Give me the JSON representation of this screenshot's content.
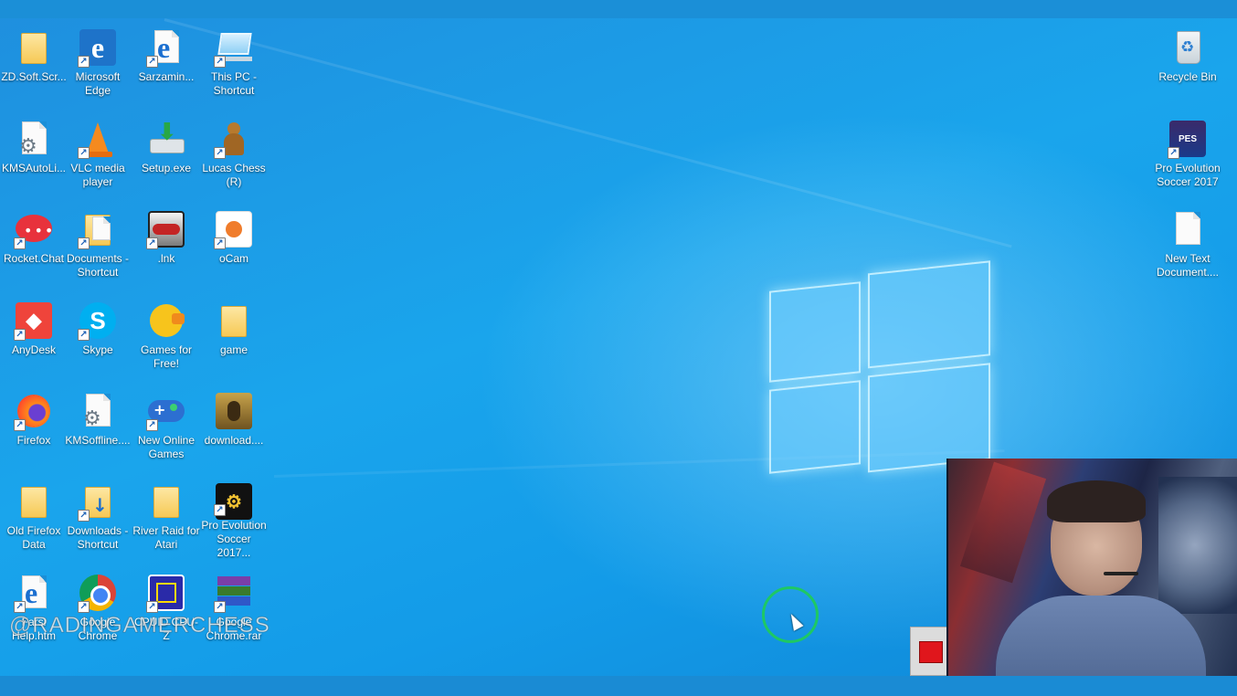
{
  "desktop": {
    "icons": [
      {
        "label": "ZD.Soft.Scr...",
        "icon": "folder-icon",
        "kind": "folder"
      },
      {
        "label": "Microsoft Edge",
        "icon": "edge-icon",
        "kind": "edge"
      },
      {
        "label": "Sarzamin...",
        "icon": "edge-icon",
        "kind": "edgepage"
      },
      {
        "label": "This PC - Shortcut",
        "icon": "this-pc-icon",
        "kind": "pc"
      },
      {
        "label": "KMSAutoLi...",
        "icon": "gear-file-icon",
        "kind": "gearpage"
      },
      {
        "label": "VLC media player",
        "icon": "vlc-cone-icon",
        "kind": "vlc"
      },
      {
        "label": "Setup.exe",
        "icon": "setup-installer-icon",
        "kind": "setup"
      },
      {
        "label": "Lucas Chess (R)",
        "icon": "chess-pawn-icon",
        "kind": "chess"
      },
      {
        "label": "Rocket.Chat",
        "icon": "rocket-chat-icon",
        "kind": "rocket"
      },
      {
        "label": "Documents - Shortcut",
        "icon": "documents-folder-icon",
        "kind": "docfolder"
      },
      {
        "label": ".lnk",
        "icon": "car-thumbnail-icon",
        "kind": "lnk"
      },
      {
        "label": "oCam",
        "icon": "ocam-icon",
        "kind": "ocam"
      },
      {
        "label": "AnyDesk",
        "icon": "anydesk-icon",
        "kind": "anydesk"
      },
      {
        "label": "Skype",
        "icon": "skype-icon",
        "kind": "skype"
      },
      {
        "label": "Games for Free!",
        "icon": "pacman-icon",
        "kind": "games"
      },
      {
        "label": "game",
        "icon": "folder-icon",
        "kind": "folder"
      },
      {
        "label": "Firefox",
        "icon": "firefox-icon",
        "kind": "firefox"
      },
      {
        "label": "KMSoffline....",
        "icon": "gear-file-icon",
        "kind": "gearpage"
      },
      {
        "label": "New Online Games",
        "icon": "gamepad-icon",
        "kind": "gamepad"
      },
      {
        "label": "download....",
        "icon": "image-thumbnail-icon",
        "kind": "download"
      },
      {
        "label": "Old Firefox Data",
        "icon": "folder-icon",
        "kind": "folder"
      },
      {
        "label": "Downloads - Shortcut",
        "icon": "downloads-folder-icon",
        "kind": "dlfolder"
      },
      {
        "label": "River Raid for Atari",
        "icon": "folder-icon",
        "kind": "folder"
      },
      {
        "label": "Pro Evolution Soccer 2017...",
        "icon": "pes-settings-icon",
        "kind": "pes"
      },
      {
        "label": "Farsi Help.htm",
        "icon": "edge-icon",
        "kind": "edgepage"
      },
      {
        "label": "Google Chrome",
        "icon": "chrome-icon",
        "kind": "chrome"
      },
      {
        "label": "CPUID CPU-Z",
        "icon": "cpu-z-icon",
        "kind": "cpuz"
      },
      {
        "label": "Google Chrome.rar",
        "icon": "winrar-icon",
        "kind": "winrar"
      }
    ],
    "right_icons": [
      {
        "label": "Recycle Bin",
        "icon": "recycle-bin-icon",
        "kind": "recycle"
      },
      {
        "label": "Pro Evolution Soccer 2017",
        "icon": "pes-game-icon",
        "kind": "pesgame"
      },
      {
        "label": "New Text Document....",
        "icon": "text-document-icon",
        "kind": "text"
      }
    ]
  },
  "watermark": "@RADINGAMERCHESS",
  "colors": {
    "desktop_blue": "#1aa5ec",
    "cursor_ring": "#1ec864",
    "record_stop": "#e0161c"
  }
}
